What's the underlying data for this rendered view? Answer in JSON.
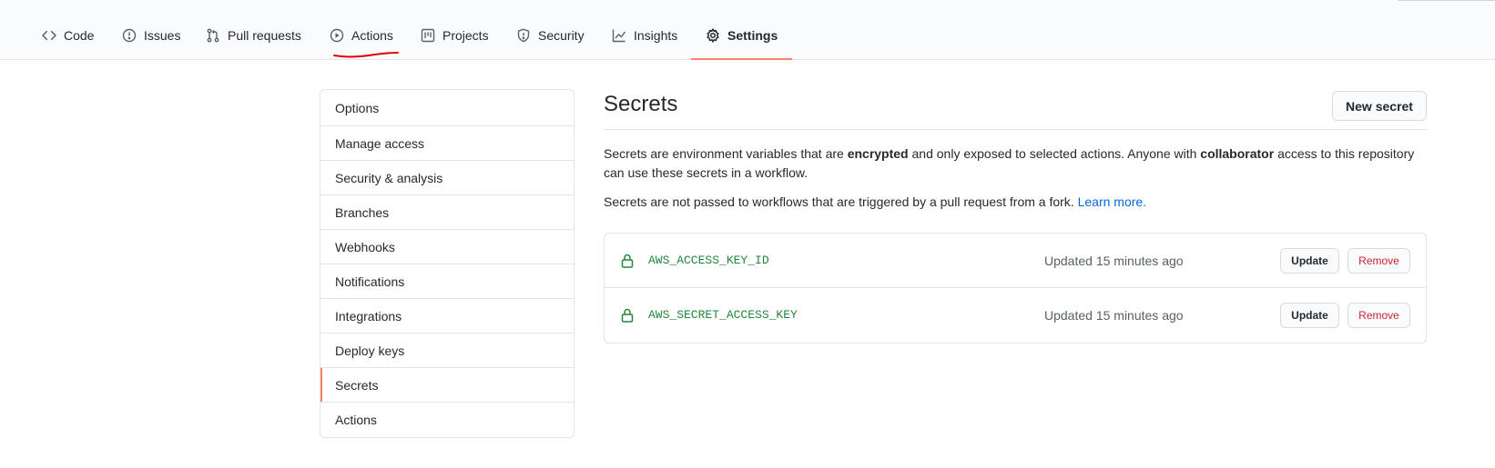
{
  "nav": {
    "tabs": [
      {
        "label": "Code",
        "icon": "code-icon"
      },
      {
        "label": "Issues",
        "icon": "issue-icon"
      },
      {
        "label": "Pull requests",
        "icon": "pull-request-icon"
      },
      {
        "label": "Actions",
        "icon": "play-icon"
      },
      {
        "label": "Projects",
        "icon": "project-icon"
      },
      {
        "label": "Security",
        "icon": "shield-icon"
      },
      {
        "label": "Insights",
        "icon": "graph-icon"
      },
      {
        "label": "Settings",
        "icon": "gear-icon",
        "selected": true
      }
    ]
  },
  "sidebar": {
    "items": [
      {
        "label": "Options"
      },
      {
        "label": "Manage access"
      },
      {
        "label": "Security & analysis"
      },
      {
        "label": "Branches"
      },
      {
        "label": "Webhooks"
      },
      {
        "label": "Notifications"
      },
      {
        "label": "Integrations"
      },
      {
        "label": "Deploy keys"
      },
      {
        "label": "Secrets",
        "selected": true
      },
      {
        "label": "Actions"
      }
    ]
  },
  "main": {
    "title": "Secrets",
    "new_button": "New secret",
    "desc1": {
      "part1": "Secrets are environment variables that are ",
      "bold1": "encrypted",
      "part2": " and only exposed to selected actions. Anyone with ",
      "bold2": "collaborator",
      "part3": " access to this repository can use these secrets in a workflow."
    },
    "desc2": {
      "text": "Secrets are not passed to workflows that are triggered by a pull request from a fork. ",
      "link": "Learn more."
    },
    "secrets": [
      {
        "name": "AWS_ACCESS_KEY_ID",
        "updated": "Updated 15 minutes ago",
        "update_label": "Update",
        "remove_label": "Remove"
      },
      {
        "name": "AWS_SECRET_ACCESS_KEY",
        "updated": "Updated 15 minutes ago",
        "update_label": "Update",
        "remove_label": "Remove"
      }
    ]
  },
  "colors": {
    "accent_underline": "#f9826c",
    "secret_name": "#22863a",
    "remove_red": "#cb2431",
    "link_blue": "#0366d6",
    "annotation_red": "#e00000"
  }
}
